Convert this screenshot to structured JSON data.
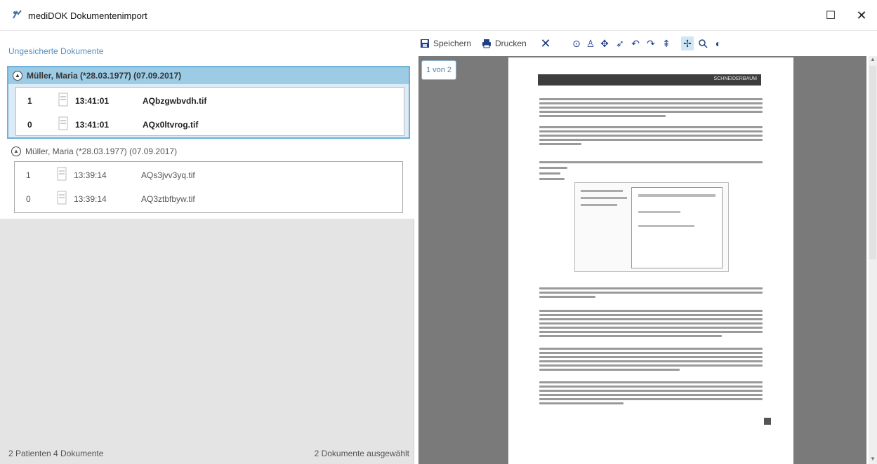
{
  "window": {
    "title": "mediDOK Dokumentenimport",
    "maximize_label": "☐",
    "close_label": "✕"
  },
  "left": {
    "section_title": "Ungesicherte Dokumente",
    "groups": [
      {
        "title": "Müller, Maria (*28.03.1977) (07.09.2017)",
        "rows": [
          {
            "idx": "1",
            "time": "13:41:01",
            "file": "AQbzgwbvdh.tif"
          },
          {
            "idx": "0",
            "time": "13:41:01",
            "file": "AQx0ltvrog.tif"
          }
        ]
      },
      {
        "title": "Müller, Maria (*28.03.1977) (07.09.2017)",
        "rows": [
          {
            "idx": "1",
            "time": "13:39:14",
            "file": "AQs3jvv3yq.tif"
          },
          {
            "idx": "0",
            "time": "13:39:14",
            "file": "AQ3ztbfbyw.tif"
          }
        ]
      }
    ],
    "status_left": "2 Patienten 4 Dokumente",
    "status_right": "2 Dokumente ausgewählt"
  },
  "toolbar": {
    "save_label": "Speichern",
    "print_label": "Drucken"
  },
  "viewer": {
    "page_indicator": "1 von 2",
    "doc_header": "SCHNEIDERBAUM"
  },
  "colors": {
    "accent": "#1f3f86",
    "selection": "#9ccbe6",
    "link": "#5a8fc2"
  }
}
